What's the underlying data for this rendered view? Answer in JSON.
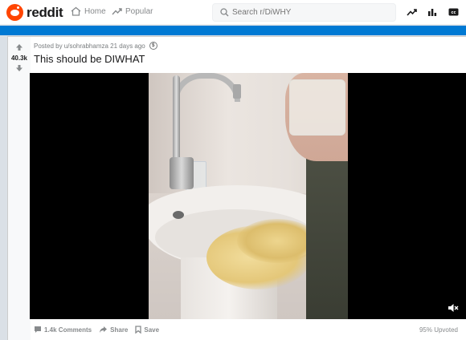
{
  "topbar": {
    "brand": "reddit",
    "nav": {
      "home": "Home",
      "popular": "Popular"
    },
    "search": {
      "placeholder": "Search r/DiWHY"
    }
  },
  "post": {
    "score": "40.3k",
    "meta": "Posted by u/sohrabhamza 21 days ago",
    "title": "This should be DIWHAT",
    "actions": {
      "comments": "1.4k Comments",
      "share": "Share",
      "save": "Save"
    },
    "upvoted": "95% Upvoted"
  },
  "colors": {
    "brand": "#ff4500",
    "accent_strip": "#0079d3",
    "text": "#1a1a1b",
    "muted": "#878a8c"
  },
  "icons": [
    "reddit-logo",
    "home-icon",
    "popular-icon",
    "search-icon",
    "trending-icon",
    "stats-icon",
    "closed-captions-icon",
    "upvote-icon",
    "downvote-icon",
    "award-icon",
    "comment-icon",
    "share-icon",
    "save-icon",
    "mute-icon"
  ]
}
